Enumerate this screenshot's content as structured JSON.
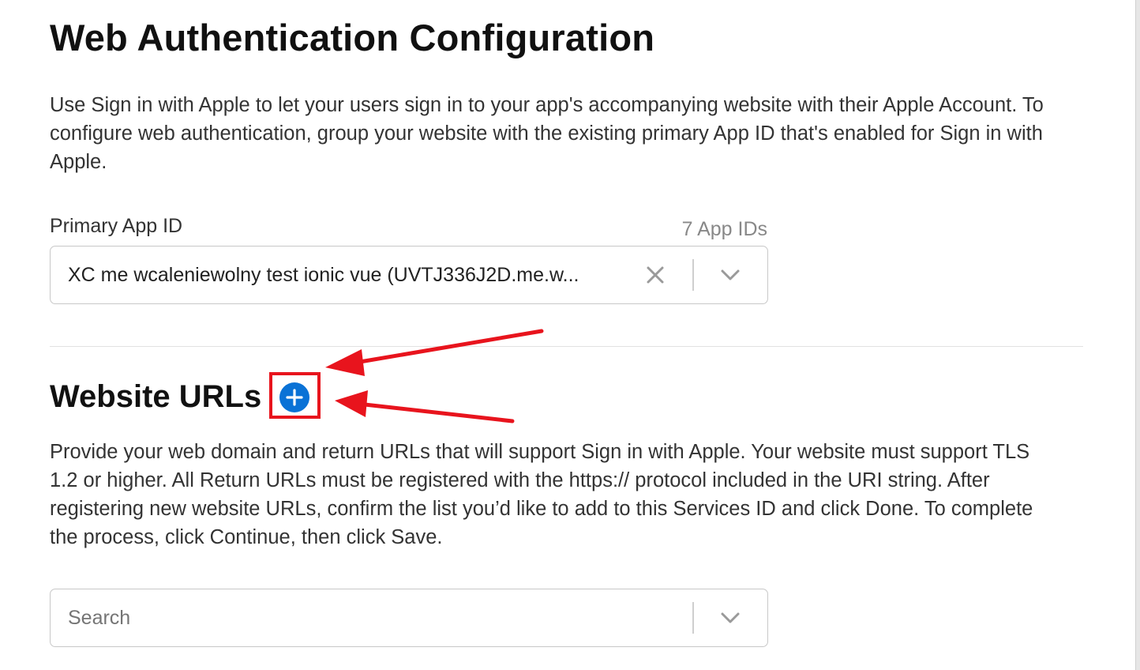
{
  "page": {
    "title": "Web Authentication Configuration",
    "description": "Use Sign in with Apple to let your users sign in to your app's accompanying website with their Apple Account. To configure web authentication, group your website with the existing primary App ID that's enabled for Sign in with Apple."
  },
  "primary_app_id": {
    "label": "Primary App ID",
    "count": "7 App IDs",
    "selected_value": "XC me wcaleniewolny test ionic vue (UVTJ336J2D.me.w..."
  },
  "website_urls": {
    "title": "Website URLs",
    "description": "Provide your web domain and return URLs that will support Sign in with Apple. Your website must support TLS 1.2 or higher. All Return URLs must be registered with the https:// protocol included in the URI string. After registering new website URLs, confirm the list you’d like to add to this Services ID and click Done. To complete the process, click Continue, then click Save.",
    "search_placeholder": "Search"
  },
  "icons": {
    "clear": "close-icon",
    "dropdown": "chevron-down-icon",
    "add": "plus-circle-icon"
  },
  "colors": {
    "add_button": "#0a72d6",
    "annotation_red": "#e8141d",
    "border": "#c8c8c8"
  }
}
